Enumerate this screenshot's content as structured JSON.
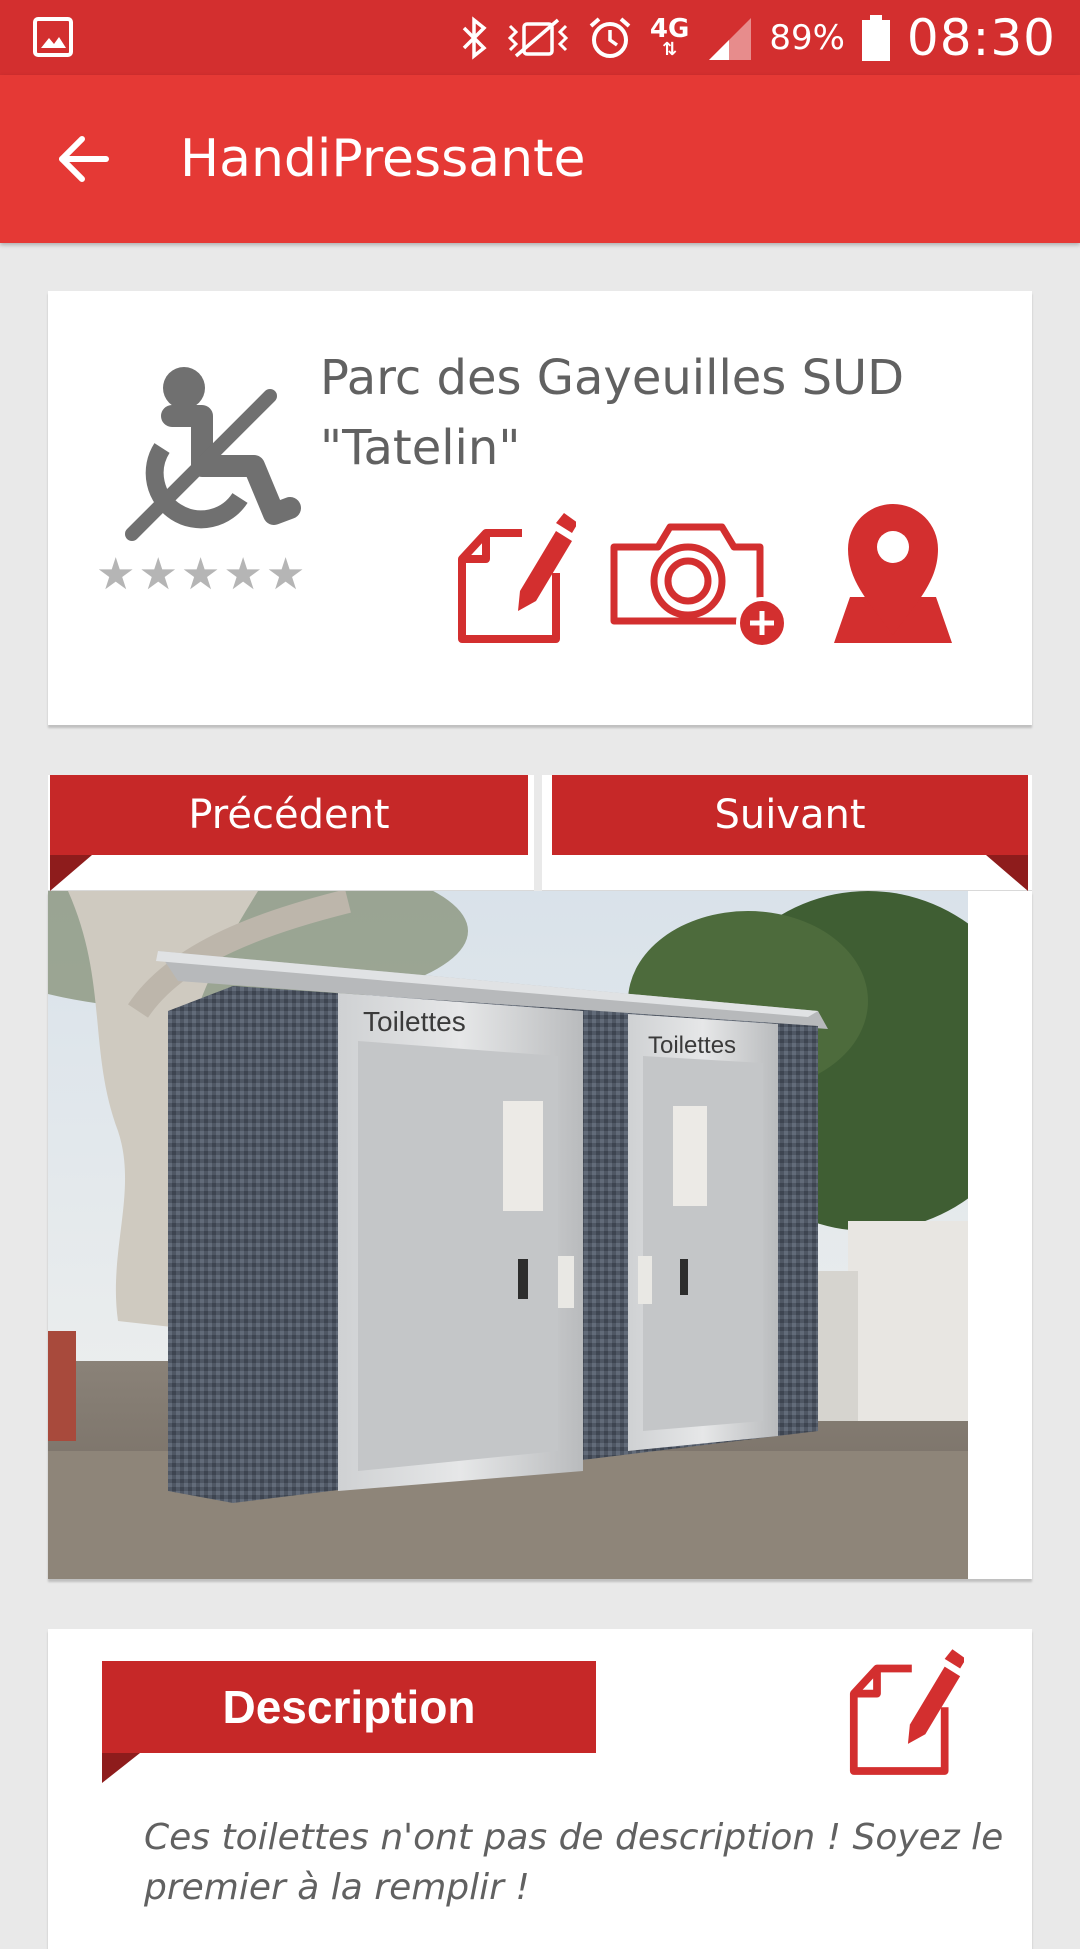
{
  "status_bar": {
    "battery_percent": "89%",
    "clock": "08:30",
    "network": "4G",
    "icons": [
      "gallery-icon",
      "bluetooth-icon",
      "vibrate-icon",
      "alarm-icon",
      "signal-icon",
      "battery-icon"
    ]
  },
  "app_bar": {
    "title": "HandiPressante",
    "back_icon": "arrow-left-icon"
  },
  "place": {
    "name": "Parc des Gayeuilles SUD \"Tatelin\"",
    "rating": 0,
    "max_rating": 5,
    "star_glyph": "★",
    "accessibility_icon": "wheelchair-not-accessible-icon",
    "actions": [
      {
        "name": "edit-place",
        "icon": "edit-note-icon"
      },
      {
        "name": "add-photo",
        "icon": "camera-add-icon"
      },
      {
        "name": "show-map",
        "icon": "map-pin-icon"
      }
    ]
  },
  "photo_nav": {
    "previous_label": "Précédent",
    "next_label": "Suivant"
  },
  "photo": {
    "sign_left": "Toilettes",
    "sign_right": "Toilettes"
  },
  "description": {
    "header": "Description",
    "text": "Ces toilettes n'ont pas de description ! Soyez le premier à la remplir !",
    "edit_icon": "edit-note-icon"
  },
  "colors": {
    "status_bar": "#d32f2f",
    "app_bar": "#e53935",
    "ribbon": "#c62828",
    "ribbon_fold": "#8e1c1c",
    "accent_red": "#d32f2f",
    "text_gray": "#616161",
    "star_gray": "#b5b5b5",
    "background": "#e9e9e9"
  }
}
